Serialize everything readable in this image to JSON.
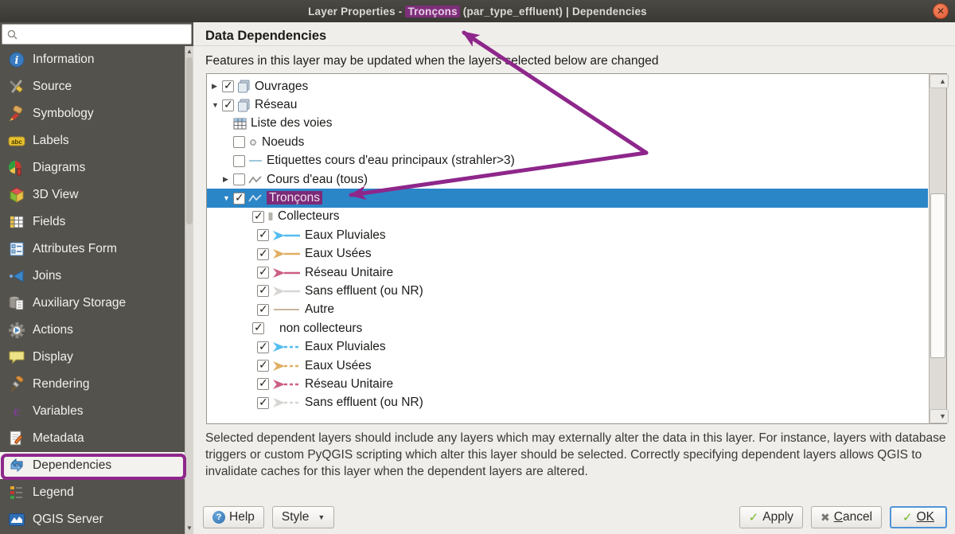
{
  "titlebar": {
    "prefix": "Layer Properties - ",
    "highlight": "Tronçons",
    "suffix": " (par_type_effluent) | Dependencies",
    "close_glyph": "✕"
  },
  "sidebar": {
    "search": {
      "placeholder": ""
    },
    "items": [
      {
        "label": "Information",
        "icon": "information-icon"
      },
      {
        "label": "Source",
        "icon": "source-icon"
      },
      {
        "label": "Symbology",
        "icon": "symbology-icon"
      },
      {
        "label": "Labels",
        "icon": "labels-icon"
      },
      {
        "label": "Diagrams",
        "icon": "diagrams-icon"
      },
      {
        "label": "3D View",
        "icon": "3d-view-icon"
      },
      {
        "label": "Fields",
        "icon": "fields-icon"
      },
      {
        "label": "Attributes Form",
        "icon": "attributes-form-icon"
      },
      {
        "label": "Joins",
        "icon": "joins-icon"
      },
      {
        "label": "Auxiliary Storage",
        "icon": "auxiliary-storage-icon"
      },
      {
        "label": "Actions",
        "icon": "actions-icon"
      },
      {
        "label": "Display",
        "icon": "display-icon"
      },
      {
        "label": "Rendering",
        "icon": "rendering-icon"
      },
      {
        "label": "Variables",
        "icon": "variables-icon"
      },
      {
        "label": "Metadata",
        "icon": "metadata-icon"
      },
      {
        "label": "Dependencies",
        "icon": "dependencies-icon",
        "selected": true,
        "annotated": true
      },
      {
        "label": "Legend",
        "icon": "legend-icon"
      },
      {
        "label": "QGIS Server",
        "icon": "qgis-server-icon"
      }
    ]
  },
  "content": {
    "heading": "Data Dependencies",
    "instruction": "Features in this layer may be updated when the layers selected below are changed",
    "tree": [
      {
        "label": "Ouvrages",
        "level": 0,
        "expander": "closed",
        "checked": true,
        "icon": "group-icon"
      },
      {
        "label": "Réseau",
        "level": 0,
        "expander": "open",
        "checked": true,
        "icon": "group-icon"
      },
      {
        "label": "Liste des voies",
        "level": 1,
        "expander": null,
        "checked": null,
        "icon": "table-icon"
      },
      {
        "label": "Noeuds",
        "level": 1,
        "expander": null,
        "checked": false,
        "icon": "point-icon"
      },
      {
        "label": "Etiquettes cours d'eau principaux (strahler>3)",
        "level": 1,
        "expander": null,
        "checked": false,
        "icon": "line-blue-icon"
      },
      {
        "label": "Cours d'eau (tous)",
        "level": 1,
        "expander": "closed",
        "checked": false,
        "icon": "polyline-icon"
      },
      {
        "label": "Tronçons",
        "level": 1,
        "expander": "open",
        "checked": true,
        "icon": "polyline-icon",
        "selected": true,
        "text_highlighted": true
      },
      {
        "label": "Collecteurs",
        "level": 2,
        "expander": null,
        "checked": true,
        "icon": "bar-icon"
      },
      {
        "label": "Eaux Pluviales",
        "level": 3,
        "expander": null,
        "checked": true,
        "icon": "arrow-symbol",
        "color": "#53bdf0",
        "dashed": false
      },
      {
        "label": "Eaux Usées",
        "level": 3,
        "expander": null,
        "checked": true,
        "icon": "arrow-symbol",
        "color": "#dfaf63",
        "dashed": false
      },
      {
        "label": "Réseau Unitaire",
        "level": 3,
        "expander": null,
        "checked": true,
        "icon": "arrow-symbol",
        "color": "#cc5f85",
        "dashed": false
      },
      {
        "label": "Sans effluent (ou NR)",
        "level": 3,
        "expander": null,
        "checked": true,
        "icon": "arrow-symbol",
        "color": "#d8d6d2",
        "dashed": false
      },
      {
        "label": "Autre",
        "level": 3,
        "expander": null,
        "checked": true,
        "icon": "line-symbol",
        "color": "#c9b79e"
      },
      {
        "label": "non collecteurs",
        "level": 2,
        "expander": null,
        "checked": true,
        "icon": "none"
      },
      {
        "label": "Eaux Pluviales",
        "level": 3,
        "expander": null,
        "checked": true,
        "icon": "arrow-symbol",
        "color": "#53bdf0",
        "dashed": true
      },
      {
        "label": "Eaux Usées",
        "level": 3,
        "expander": null,
        "checked": true,
        "icon": "arrow-symbol",
        "color": "#dfaf63",
        "dashed": true
      },
      {
        "label": "Réseau Unitaire",
        "level": 3,
        "expander": null,
        "checked": true,
        "icon": "arrow-symbol",
        "color": "#cc5f85",
        "dashed": true
      },
      {
        "label": "Sans effluent (ou NR)",
        "level": 3,
        "expander": null,
        "checked": true,
        "icon": "arrow-symbol",
        "color": "#d8d6d2",
        "dashed": true
      }
    ],
    "note": "Selected dependent layers should include any layers which may externally alter the data in this layer. For instance, layers with database triggers or custom PyQGIS scripting which alter this layer should be selected. Correctly specifying dependent layers allows QGIS to invalidate caches for this layer when the dependent layers are altered."
  },
  "buttons": {
    "help": "Help",
    "style": "Style",
    "apply": "Apply",
    "cancel_initial": "C",
    "cancel_rest": "ancel",
    "ok": "OK"
  },
  "colors": {
    "selection_blue": "#2b86c8",
    "annotation_purple": "#8e278b",
    "title_highlight_bg": "#7e2f7b",
    "close_button_orange": "#e9654b",
    "sidebar_bg": "#54524d",
    "titlebar_bg": "#3c3b36"
  }
}
